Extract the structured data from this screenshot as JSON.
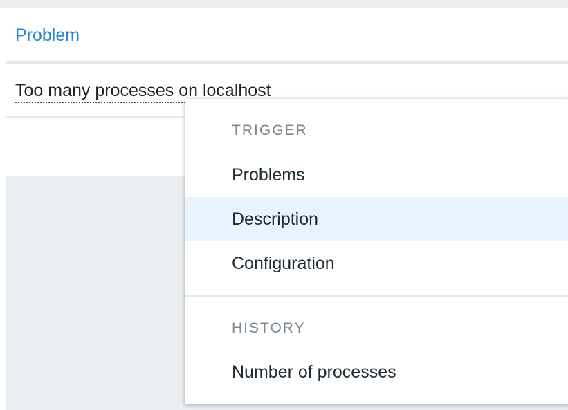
{
  "table": {
    "header_label": "Problem",
    "row_text": "Too many processes on localhost"
  },
  "context_menu": {
    "sections": [
      {
        "heading": "TRIGGER",
        "items": [
          {
            "label": "Problems",
            "highlighted": false
          },
          {
            "label": "Description",
            "highlighted": true
          },
          {
            "label": "Configuration",
            "highlighted": false
          }
        ]
      },
      {
        "heading": "HISTORY",
        "items": [
          {
            "label": "Number of processes",
            "highlighted": false
          }
        ]
      }
    ]
  },
  "colors": {
    "link": "#2a87c9",
    "highlight": "#e8f4fd",
    "heading": "#7b8791",
    "background_gray": "#ebeef0"
  }
}
